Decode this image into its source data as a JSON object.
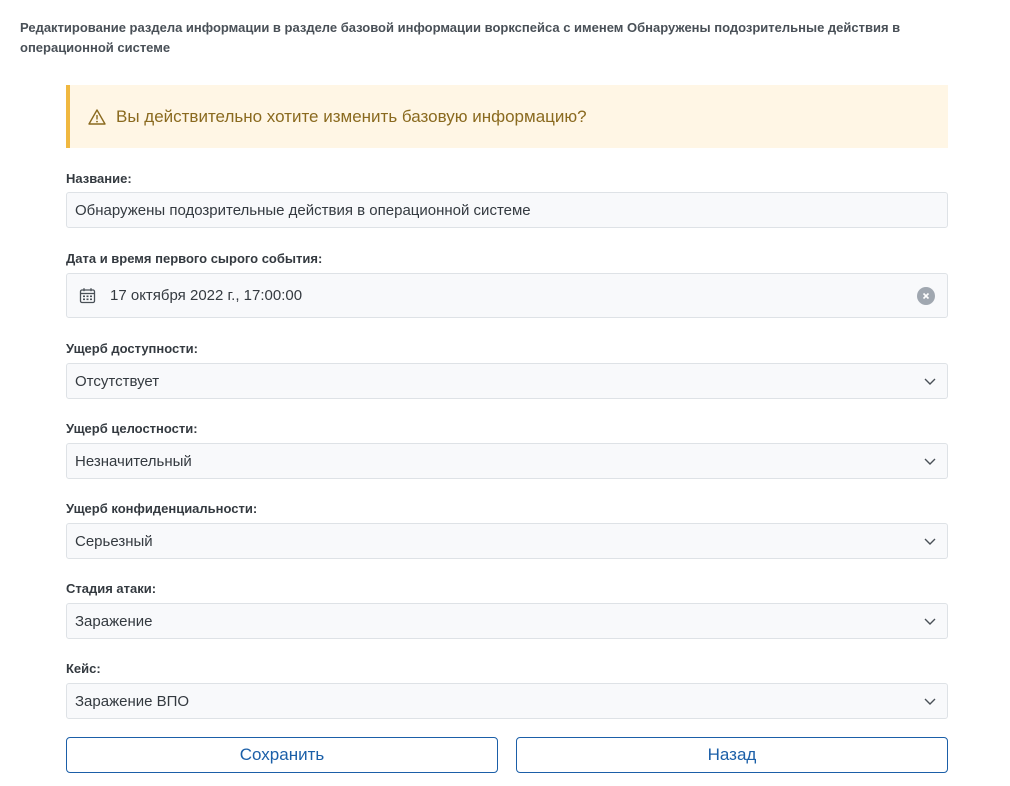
{
  "header": {
    "title": "Редактирование раздела информации в разделе базовой информации воркспейса с именем Обнаружены подозрительные действия в операционной системе"
  },
  "warning": {
    "icon": "warning-triangle-icon",
    "text": "Вы действительно хотите изменить базовую информацию?"
  },
  "fields": {
    "name": {
      "label": "Название:",
      "value": "Обнаружены подозрительные действия в операционной системе"
    },
    "first_event": {
      "label": "Дата и время первого сырого события:",
      "value": "17 октября 2022 г., 17:00:00"
    },
    "availability": {
      "label": "Ущерб доступности:",
      "value": "Отсутствует"
    },
    "integrity": {
      "label": "Ущерб целостности:",
      "value": "Незначительный"
    },
    "confidentiality": {
      "label": "Ущерб конфиденциальности:",
      "value": "Серьезный"
    },
    "attack_stage": {
      "label": "Стадия атаки:",
      "value": "Заражение"
    },
    "case": {
      "label": "Кейс:",
      "value": "Заражение ВПО"
    }
  },
  "buttons": {
    "save": "Сохранить",
    "back": "Назад"
  },
  "colors": {
    "accent": "#1b5fa8",
    "warning_bg": "#fff6e5",
    "warning_border": "#f0b840",
    "warning_text": "#8a6a1f"
  }
}
